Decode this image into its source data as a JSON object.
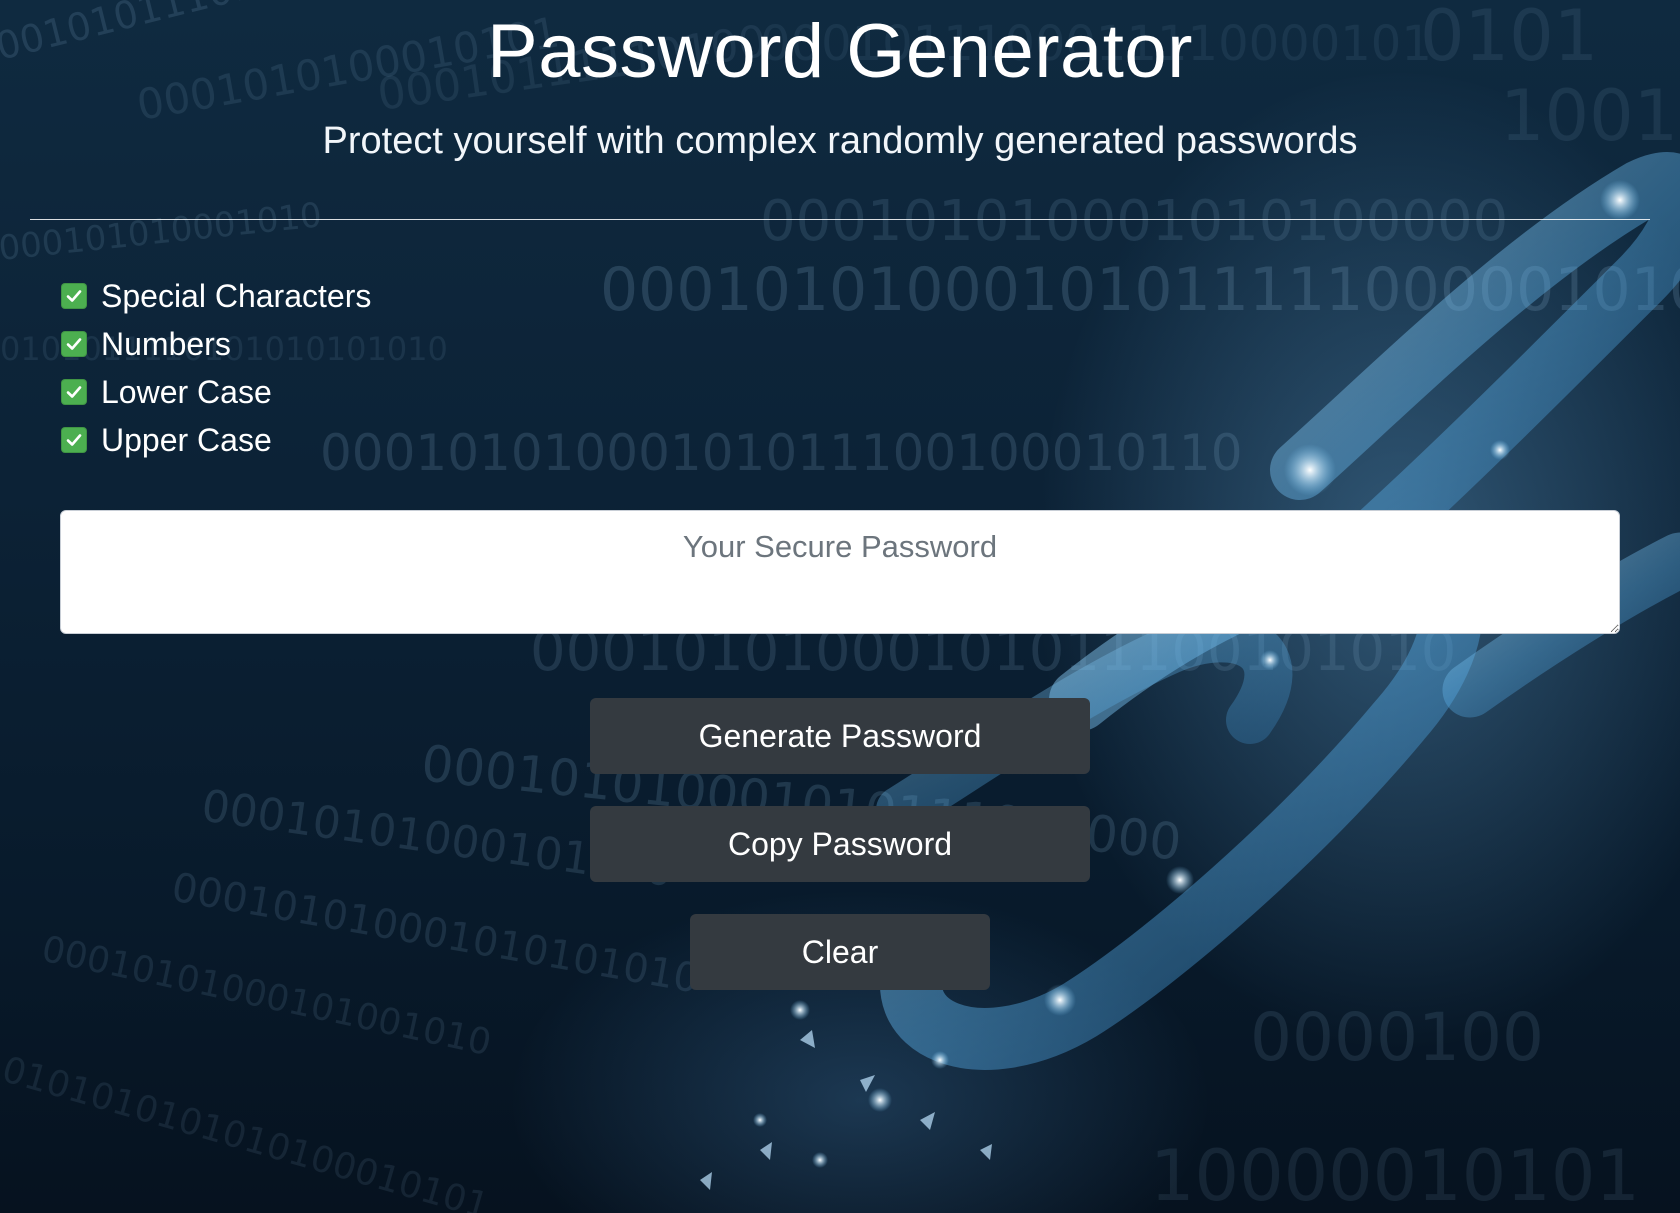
{
  "header": {
    "title": "Password Generator",
    "subtitle": "Protect yourself with complex randomly generated passwords"
  },
  "options": [
    {
      "label": "Special Characters",
      "checked": true
    },
    {
      "label": "Numbers",
      "checked": true
    },
    {
      "label": "Lower Case",
      "checked": true
    },
    {
      "label": "Upper Case",
      "checked": true
    }
  ],
  "password_field": {
    "placeholder": "Your Secure Password",
    "value": ""
  },
  "buttons": {
    "generate_label": "Generate Password",
    "copy_label": "Copy Password",
    "clear_label": "Clear"
  },
  "colors": {
    "checkbox": "#4caf50",
    "button_bg": "#343a40",
    "background_top": "#0f2a40",
    "background_bottom": "#06121f",
    "chain_glow": "#7ec8f5"
  },
  "background": {
    "image_name": "glowing-chain-binary-background",
    "icons": [
      "checkmark-icon"
    ]
  }
}
